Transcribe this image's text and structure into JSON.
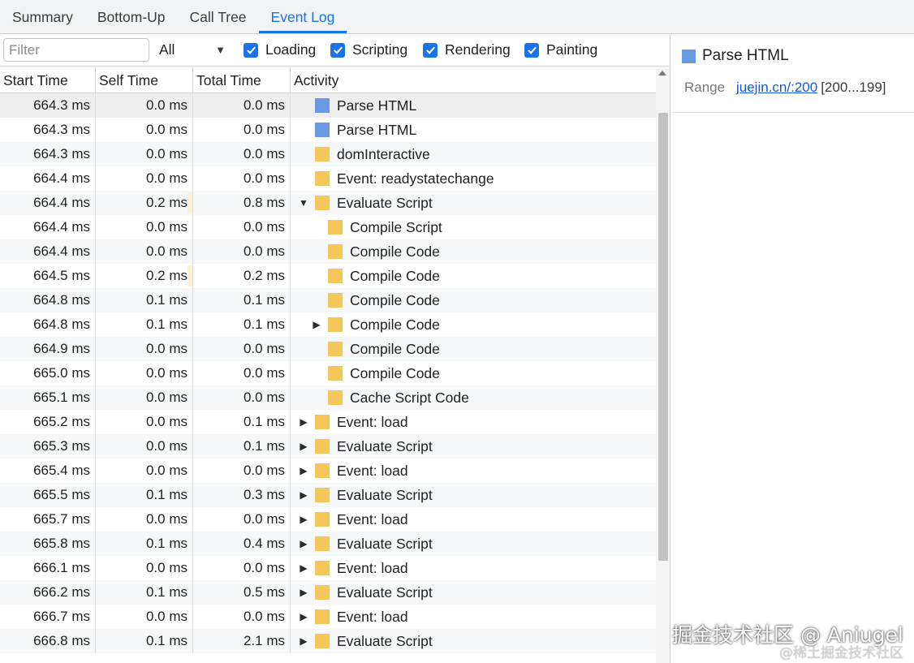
{
  "tabs": [
    {
      "label": "Summary",
      "active": false
    },
    {
      "label": "Bottom-Up",
      "active": false
    },
    {
      "label": "Call Tree",
      "active": false
    },
    {
      "label": "Event Log",
      "active": true
    }
  ],
  "filter": {
    "placeholder": "Filter",
    "value": ""
  },
  "category_select": {
    "value": "All"
  },
  "checkboxes": [
    {
      "label": "Loading",
      "checked": true
    },
    {
      "label": "Scripting",
      "checked": true
    },
    {
      "label": "Rendering",
      "checked": true
    },
    {
      "label": "Painting",
      "checked": true
    }
  ],
  "columns": [
    "Start Time",
    "Self Time",
    "Total Time",
    "Activity"
  ],
  "colors": {
    "loading": "#6a9be2",
    "scripting": "#f3c75a",
    "accent": "#1a73e8",
    "self_bar": "#fdf0d5"
  },
  "rows": [
    {
      "start": "664.3 ms",
      "self": "0.0 ms",
      "total": "0.0 ms",
      "activity": "Parse HTML",
      "cat": "loading",
      "level": 0,
      "toggle": "none",
      "selected": true
    },
    {
      "start": "664.3 ms",
      "self": "0.0 ms",
      "total": "0.0 ms",
      "activity": "Parse HTML",
      "cat": "loading",
      "level": 0,
      "toggle": "none"
    },
    {
      "start": "664.3 ms",
      "self": "0.0 ms",
      "total": "0.0 ms",
      "activity": "domInteractive",
      "cat": "scripting",
      "level": 0,
      "toggle": "none"
    },
    {
      "start": "664.4 ms",
      "self": "0.0 ms",
      "total": "0.0 ms",
      "activity": "Event: readystatechange",
      "cat": "scripting",
      "level": 0,
      "toggle": "none"
    },
    {
      "start": "664.4 ms",
      "self": "0.2 ms",
      "total": "0.8 ms",
      "activity": "Evaluate Script",
      "cat": "scripting",
      "level": 0,
      "toggle": "expanded",
      "selfbar": true
    },
    {
      "start": "664.4 ms",
      "self": "0.0 ms",
      "total": "0.0 ms",
      "activity": "Compile Script",
      "cat": "scripting",
      "level": 1,
      "toggle": "none"
    },
    {
      "start": "664.4 ms",
      "self": "0.0 ms",
      "total": "0.0 ms",
      "activity": "Compile Code",
      "cat": "scripting",
      "level": 1,
      "toggle": "none"
    },
    {
      "start": "664.5 ms",
      "self": "0.2 ms",
      "total": "0.2 ms",
      "activity": "Compile Code",
      "cat": "scripting",
      "level": 1,
      "toggle": "none",
      "selfbar": true
    },
    {
      "start": "664.8 ms",
      "self": "0.1 ms",
      "total": "0.1 ms",
      "activity": "Compile Code",
      "cat": "scripting",
      "level": 1,
      "toggle": "none"
    },
    {
      "start": "664.8 ms",
      "self": "0.1 ms",
      "total": "0.1 ms",
      "activity": "Compile Code",
      "cat": "scripting",
      "level": 1,
      "toggle": "collapsed"
    },
    {
      "start": "664.9 ms",
      "self": "0.0 ms",
      "total": "0.0 ms",
      "activity": "Compile Code",
      "cat": "scripting",
      "level": 1,
      "toggle": "none"
    },
    {
      "start": "665.0 ms",
      "self": "0.0 ms",
      "total": "0.0 ms",
      "activity": "Compile Code",
      "cat": "scripting",
      "level": 1,
      "toggle": "none"
    },
    {
      "start": "665.1 ms",
      "self": "0.0 ms",
      "total": "0.0 ms",
      "activity": "Cache Script Code",
      "cat": "scripting",
      "level": 1,
      "toggle": "none"
    },
    {
      "start": "665.2 ms",
      "self": "0.0 ms",
      "total": "0.1 ms",
      "activity": "Event: load",
      "cat": "scripting",
      "level": 0,
      "toggle": "collapsed"
    },
    {
      "start": "665.3 ms",
      "self": "0.0 ms",
      "total": "0.1 ms",
      "activity": "Evaluate Script",
      "cat": "scripting",
      "level": 0,
      "toggle": "collapsed"
    },
    {
      "start": "665.4 ms",
      "self": "0.0 ms",
      "total": "0.0 ms",
      "activity": "Event: load",
      "cat": "scripting",
      "level": 0,
      "toggle": "collapsed"
    },
    {
      "start": "665.5 ms",
      "self": "0.1 ms",
      "total": "0.3 ms",
      "activity": "Evaluate Script",
      "cat": "scripting",
      "level": 0,
      "toggle": "collapsed"
    },
    {
      "start": "665.7 ms",
      "self": "0.0 ms",
      "total": "0.0 ms",
      "activity": "Event: load",
      "cat": "scripting",
      "level": 0,
      "toggle": "collapsed"
    },
    {
      "start": "665.8 ms",
      "self": "0.1 ms",
      "total": "0.4 ms",
      "activity": "Evaluate Script",
      "cat": "scripting",
      "level": 0,
      "toggle": "collapsed"
    },
    {
      "start": "666.1 ms",
      "self": "0.0 ms",
      "total": "0.0 ms",
      "activity": "Event: load",
      "cat": "scripting",
      "level": 0,
      "toggle": "collapsed"
    },
    {
      "start": "666.2 ms",
      "self": "0.1 ms",
      "total": "0.5 ms",
      "activity": "Evaluate Script",
      "cat": "scripting",
      "level": 0,
      "toggle": "collapsed"
    },
    {
      "start": "666.7 ms",
      "self": "0.0 ms",
      "total": "0.0 ms",
      "activity": "Event: load",
      "cat": "scripting",
      "level": 0,
      "toggle": "collapsed"
    },
    {
      "start": "666.8 ms",
      "self": "0.1 ms",
      "total": "2.1 ms",
      "activity": "Evaluate Script",
      "cat": "scripting",
      "level": 0,
      "toggle": "collapsed"
    }
  ],
  "detail": {
    "title": "Parse HTML",
    "range_label": "Range",
    "range_link": "juejin.cn/:200",
    "range_value": "[200...199]"
  },
  "watermark": {
    "main": "掘金技术社区 @ Aniugel",
    "sub": "@稀土掘金技术社区"
  }
}
